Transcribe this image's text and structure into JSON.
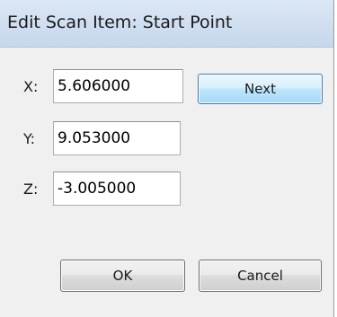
{
  "dialog": {
    "title": "Edit Scan Item: Start Point",
    "fields": {
      "x": {
        "label": "X:",
        "value": "5.606000"
      },
      "y": {
        "label": "Y:",
        "value": "9.053000"
      },
      "z": {
        "label": "Z:",
        "value": "-3.005000"
      }
    },
    "buttons": {
      "next": "Next",
      "ok": "OK",
      "cancel": "Cancel"
    }
  }
}
